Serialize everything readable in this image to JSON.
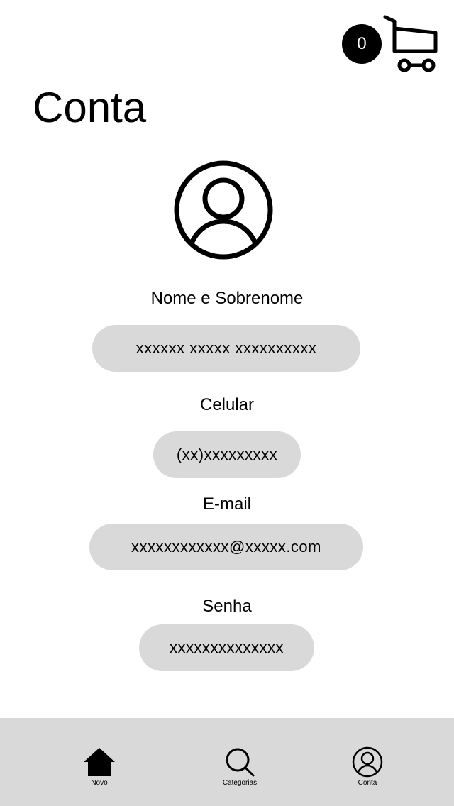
{
  "header": {
    "cart_count": "0",
    "title": "Conta"
  },
  "form": {
    "name": {
      "label": "Nome e Sobrenome",
      "value": "xxxxxx xxxxx xxxxxxxxxx"
    },
    "phone": {
      "label": "Celular",
      "value": "(xx)xxxxxxxxx"
    },
    "email": {
      "label": "E-mail",
      "value": "xxxxxxxxxxxx@xxxxx.com"
    },
    "password": {
      "label": "Senha",
      "value": "xxxxxxxxxxxxxx"
    }
  },
  "bottom_nav": {
    "items": [
      {
        "label": "Novo",
        "icon": "home-icon"
      },
      {
        "label": "Categorias",
        "icon": "search-icon"
      },
      {
        "label": "Conta",
        "icon": "account-icon"
      }
    ]
  }
}
